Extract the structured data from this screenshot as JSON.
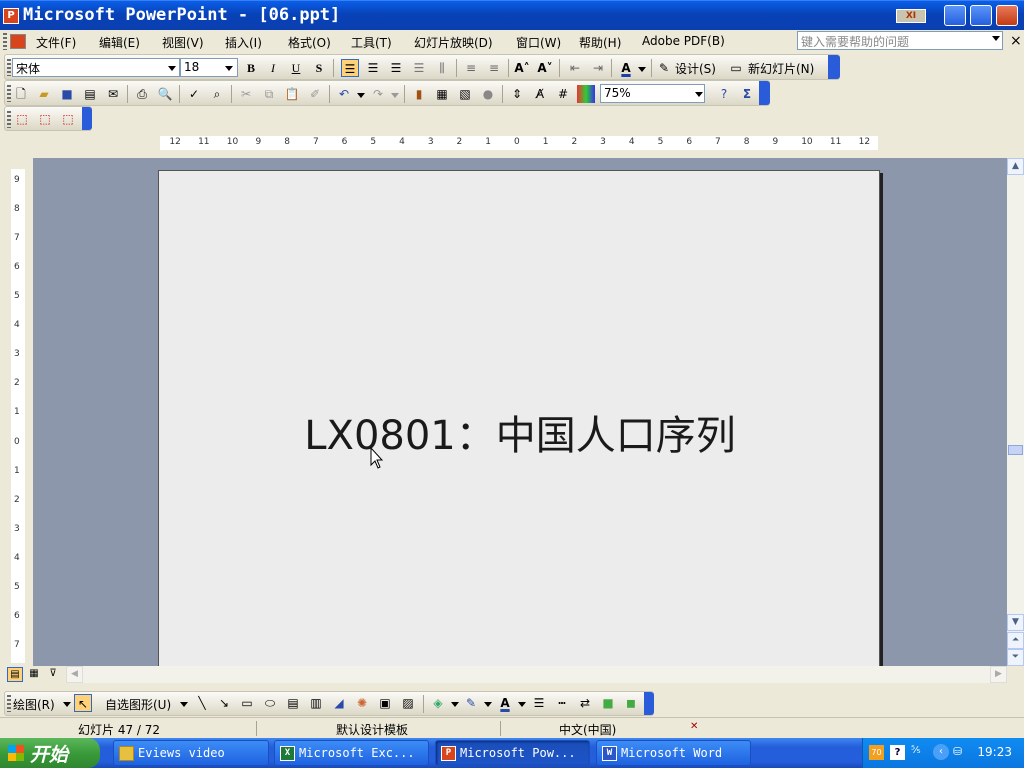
{
  "window": {
    "title": "Microsoft PowerPoint - [06.ppt]",
    "app_icon": "powerpoint-icon"
  },
  "menu": {
    "items": [
      "文件(F)",
      "编辑(E)",
      "视图(V)",
      "插入(I)",
      "格式(O)",
      "工具(T)",
      "幻灯片放映(D)",
      "窗口(W)",
      "帮助(H)",
      "Adobe PDF(B)"
    ],
    "help_placeholder": "键入需要帮助的问题"
  },
  "format_toolbar": {
    "font": "宋体",
    "size": "18",
    "bold": "B",
    "italic": "I",
    "underline": "U",
    "shadow": "S",
    "design_label": "设计(S)",
    "new_slide_label": "新幻灯片(N)"
  },
  "standard_toolbar": {
    "zoom": "75%"
  },
  "slide": {
    "title": "LX0801：中国人口序列"
  },
  "drawing_toolbar": {
    "draw_label": "绘图(R)",
    "autoshapes_label": "自选图形(U)"
  },
  "status": {
    "slide_info": "幻灯片 47 / 72",
    "template": "默认设计模板",
    "language": "中文(中国)"
  },
  "taskbar": {
    "start_label": "开始",
    "tasks": [
      {
        "label": "Eviews video",
        "icon": "folder-icon"
      },
      {
        "label": "Microsoft Exc...",
        "icon": "excel-icon"
      },
      {
        "label": "Microsoft Pow...",
        "icon": "powerpoint-icon"
      },
      {
        "label": "Microsoft Word",
        "icon": "word-icon"
      }
    ],
    "clock": "19:23"
  },
  "ruler": {
    "horizontal": [
      "12",
      "11",
      "10",
      "9",
      "8",
      "7",
      "6",
      "5",
      "4",
      "3",
      "2",
      "1",
      "0",
      "1",
      "2",
      "3",
      "4",
      "5",
      "6",
      "7",
      "8",
      "9",
      "10",
      "11",
      "12"
    ],
    "vertical": [
      "9",
      "8",
      "7",
      "6",
      "5",
      "4",
      "3",
      "2",
      "1",
      "0",
      "1",
      "2",
      "3",
      "4",
      "5",
      "6",
      "7"
    ]
  },
  "colors": {
    "titlebar": "#0842b8",
    "workspace": "#8c97ab",
    "slide_bg": "#ececec",
    "taskbar": "#245edb",
    "start": "#3a9b3a"
  }
}
